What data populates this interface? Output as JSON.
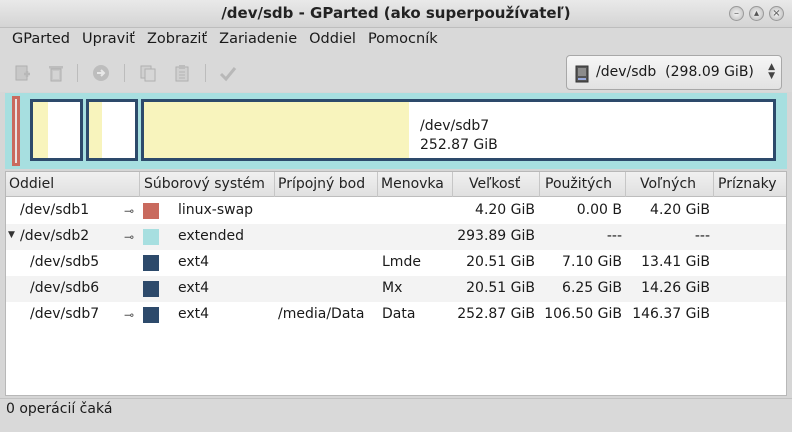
{
  "window": {
    "title": "/dev/sdb - GParted (ako superpoužívateľ)"
  },
  "menubar": {
    "items": [
      "GParted",
      "Upraviť",
      "Zobraziť",
      "Zariadenie",
      "Oddiel",
      "Pomocník"
    ]
  },
  "toolbar": {
    "buttons": [
      {
        "icon": "new-icon"
      },
      {
        "icon": "delete-icon"
      },
      {
        "icon": "resize-move-icon"
      },
      {
        "icon": "copy-icon"
      },
      {
        "icon": "paste-icon"
      },
      {
        "icon": "apply-icon"
      }
    ]
  },
  "device_selector": {
    "label": "/dev/sdb  (298.09 GiB)"
  },
  "disk_map": {
    "selected": {
      "name": "/dev/sdb7",
      "size": "252.87 GiB"
    }
  },
  "colors": {
    "linux_swap": "#c96a5e",
    "extended": "#a7dfe0",
    "ext4": "#2d4a6b",
    "used_space": "#f8f4bd"
  },
  "table": {
    "headers": [
      "Oddiel",
      "Súborový systém",
      "Prípojný bod",
      "Menovka",
      "Veľkosť",
      "Použitých",
      "Voľných",
      "Príznaky"
    ],
    "rows": [
      {
        "partition": "/dev/sdb1",
        "fs": "linux-swap",
        "mount": "",
        "label": "",
        "size": "4.20 GiB",
        "used": "0.00 B",
        "free": "4.20 GiB",
        "flags": "",
        "key": true,
        "indent": 0,
        "color": "#c96a5e"
      },
      {
        "partition": "/dev/sdb2",
        "fs": "extended",
        "mount": "",
        "label": "",
        "size": "293.89 GiB",
        "used": "---",
        "free": "---",
        "flags": "",
        "key": true,
        "indent": 0,
        "color": "#a7dfe0",
        "expanded": true
      },
      {
        "partition": "/dev/sdb5",
        "fs": "ext4",
        "mount": "",
        "label": "Lmde",
        "size": "20.51 GiB",
        "used": "7.10 GiB",
        "free": "13.41 GiB",
        "flags": "",
        "key": false,
        "indent": 1,
        "color": "#2d4a6b"
      },
      {
        "partition": "/dev/sdb6",
        "fs": "ext4",
        "mount": "",
        "label": "Mx",
        "size": "20.51 GiB",
        "used": "6.25 GiB",
        "free": "14.26 GiB",
        "flags": "",
        "key": false,
        "indent": 1,
        "color": "#2d4a6b"
      },
      {
        "partition": "/dev/sdb7",
        "fs": "ext4",
        "mount": "/media/Data",
        "label": "Data",
        "size": "252.87 GiB",
        "used": "106.50 GiB",
        "free": "146.37 GiB",
        "flags": "",
        "key": true,
        "indent": 1,
        "color": "#2d4a6b"
      }
    ]
  },
  "status": {
    "text": "0 operácií čaká"
  }
}
